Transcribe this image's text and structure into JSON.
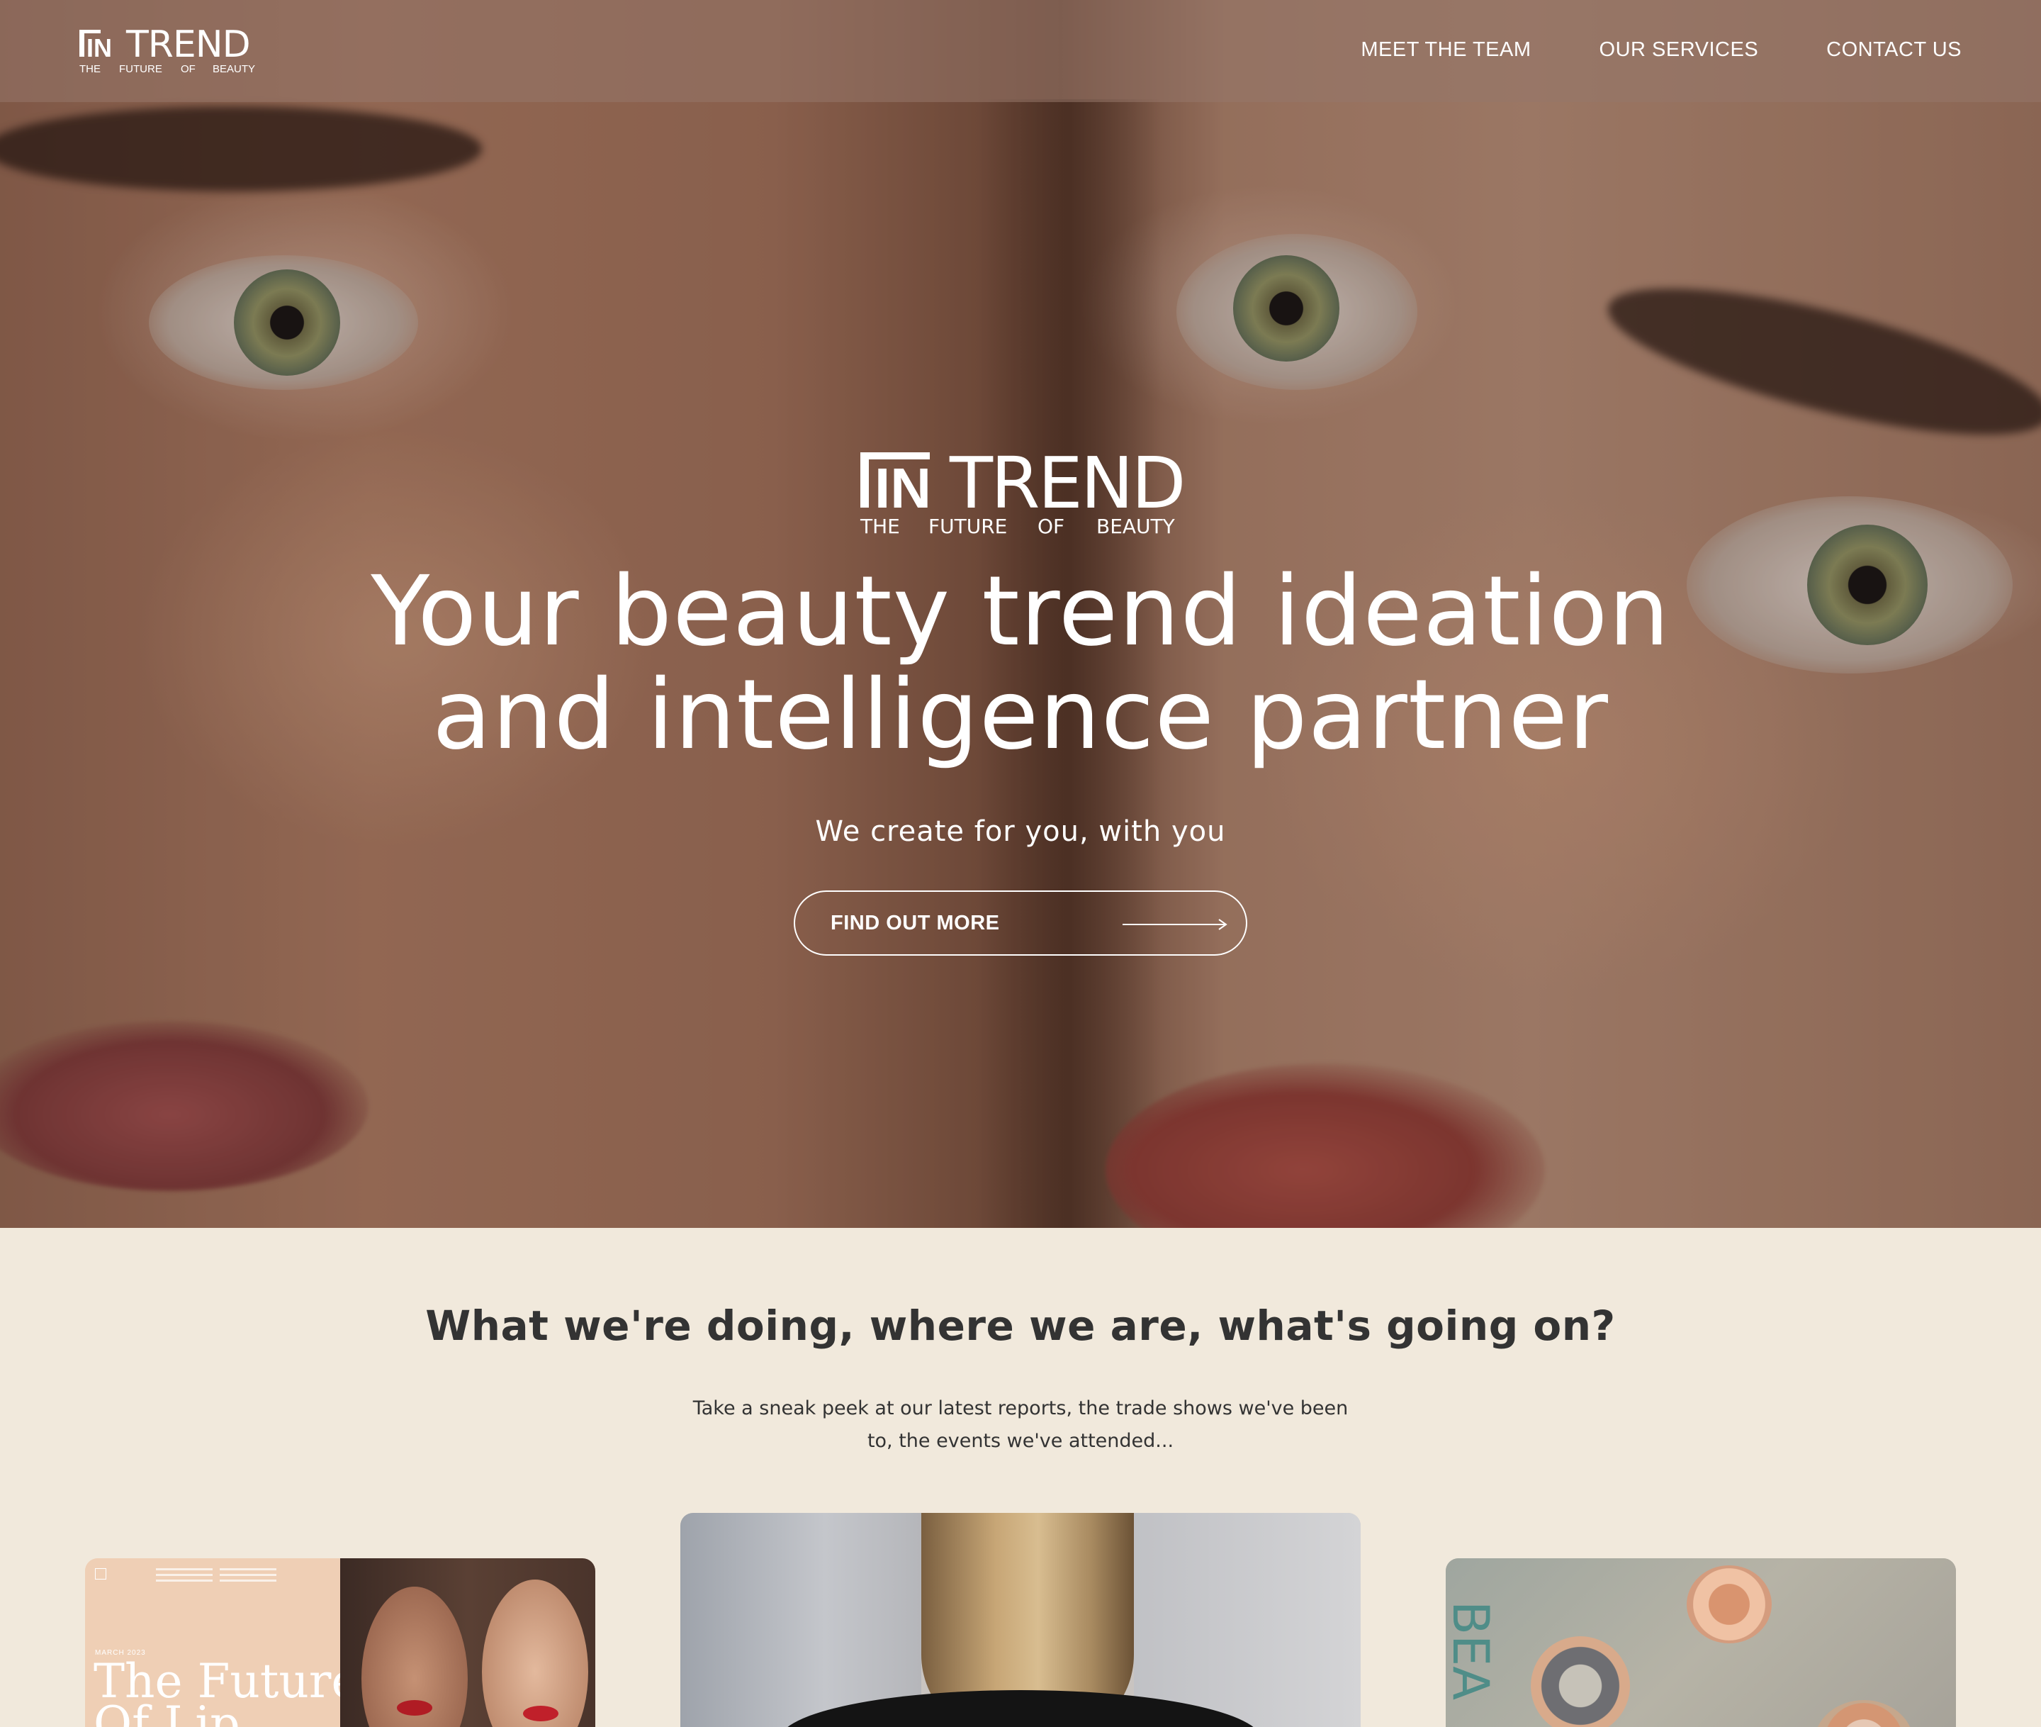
{
  "brand": {
    "name_mark": "IN",
    "name_word": "TREND",
    "tagline_words": [
      "THE",
      "FUTURE",
      "OF",
      "BEAUTY"
    ]
  },
  "nav": {
    "items": [
      {
        "label": "MEET THE TEAM"
      },
      {
        "label": "OUR SERVICES"
      },
      {
        "label": "CONTACT US"
      }
    ]
  },
  "hero": {
    "headline_line1": "Your beauty trend ideation",
    "headline_line2": "and intelligence partner",
    "subline": "We create for you, with you",
    "cta_label": "FIND OUT MORE"
  },
  "news": {
    "title": "What we're doing, where we are, what's going on?",
    "description": "Take a sneak peek at our latest reports, the trade shows we've been to, the events we've attended...",
    "cards": [
      {
        "date": "MARCH 2023",
        "title_line1": "The Future",
        "title_line2": "Of Lip"
      },
      {},
      {
        "partial_text": "BEA"
      }
    ]
  },
  "colors": {
    "section_bg": "#f1e9dc",
    "heading_text": "#333333",
    "hero_text": "#ffffff"
  }
}
